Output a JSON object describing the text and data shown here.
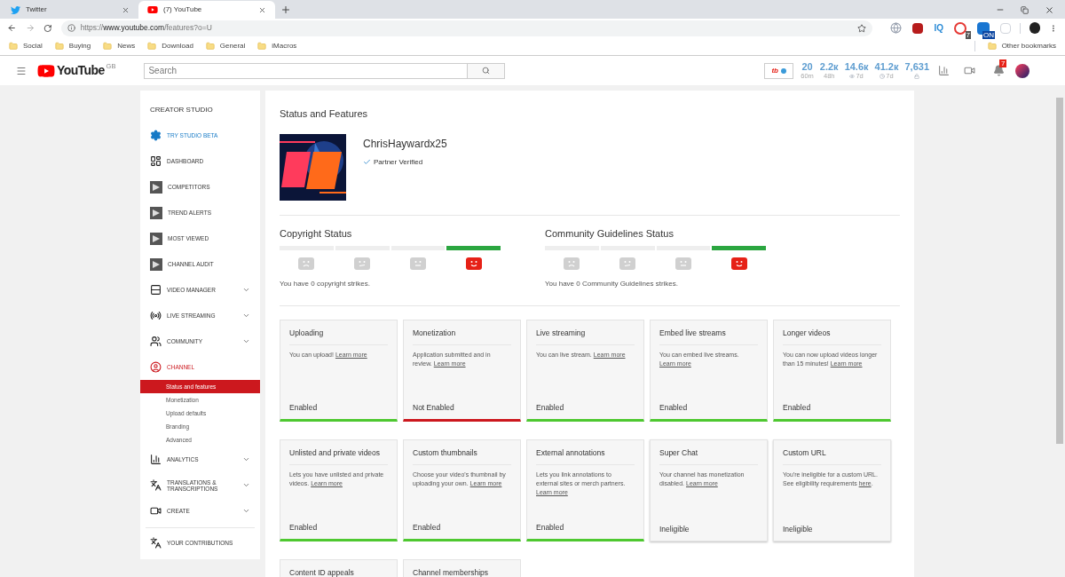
{
  "browser": {
    "tabs": [
      {
        "title": "Twitter",
        "kind": "twitter",
        "selected": false
      },
      {
        "title": "(7) YouTube",
        "kind": "youtube",
        "selected": true
      }
    ],
    "url_scheme": "https://",
    "url_host": "www.youtube.com",
    "url_path": "/features?o=U",
    "extensions": [
      {
        "kind": "globe"
      },
      {
        "kind": "red_square"
      },
      {
        "kind": "text",
        "label": "IQ"
      },
      {
        "kind": "badge_red",
        "badge": "7"
      },
      {
        "kind": "badge_blue",
        "badge": "ON"
      },
      {
        "kind": "blank"
      }
    ],
    "bookmarks": [
      "Social",
      "Buying",
      "News",
      "Download",
      "General",
      "iMacros"
    ],
    "other_bookmarks": "Other bookmarks"
  },
  "header": {
    "logo": "YouTube",
    "region": "GB",
    "search_placeholder": "Search",
    "widget_logo": "tb",
    "notification_count": "7",
    "stats": [
      {
        "value": "20",
        "sub": "60m",
        "kind": "plain"
      },
      {
        "value": "2.2к",
        "sub": "48h",
        "kind": "plain"
      },
      {
        "value": "14.6к",
        "sub": "7d",
        "kind": "views"
      },
      {
        "value": "41.2к",
        "sub": "7d",
        "kind": "time"
      },
      {
        "value": "7,631",
        "kind": "lock"
      }
    ]
  },
  "sidebar": {
    "title": "CREATOR STUDIO",
    "items": [
      {
        "label": "TRY STUDIO BETA",
        "kind": "gear",
        "expandable": false,
        "selected": false
      },
      {
        "label": "DASHBOARD",
        "kind": "dashboard",
        "expandable": false,
        "selected": false
      },
      {
        "label": "COMPETITORS",
        "kind": "plugin",
        "expandable": false,
        "selected": false
      },
      {
        "label": "TREND ALERTS",
        "kind": "plugin",
        "expandable": false,
        "selected": false
      },
      {
        "label": "MOST VIEWED",
        "kind": "plugin",
        "expandable": false,
        "selected": false
      },
      {
        "label": "CHANNEL AUDIT",
        "kind": "plugin",
        "expandable": false,
        "selected": false
      },
      {
        "label": "VIDEO MANAGER",
        "kind": "manager",
        "expandable": true,
        "selected": false
      },
      {
        "label": "LIVE STREAMING",
        "kind": "live",
        "expandable": true,
        "selected": false
      },
      {
        "label": "COMMUNITY",
        "kind": "community",
        "expandable": true,
        "selected": false
      },
      {
        "label": "CHANNEL",
        "kind": "channel",
        "expandable": false,
        "selected": true,
        "children": [
          {
            "label": "Status and features",
            "selected": true
          },
          {
            "label": "Monetization",
            "selected": false
          },
          {
            "label": "Upload defaults",
            "selected": false
          },
          {
            "label": "Branding",
            "selected": false
          },
          {
            "label": "Advanced",
            "selected": false
          }
        ]
      },
      {
        "label": "ANALYTICS",
        "kind": "analytics",
        "expandable": true,
        "selected": false
      },
      {
        "label": "TRANSLATIONS & TRANSCRIPTIONS",
        "kind": "translate",
        "expandable": true,
        "selected": false
      },
      {
        "label": "CREATE",
        "kind": "create",
        "expandable": true,
        "selected": false
      },
      {
        "label": "YOUR CONTRIBUTIONS",
        "kind": "translate",
        "expandable": false,
        "selected": false,
        "separated": true
      }
    ]
  },
  "main": {
    "title": "Status and Features",
    "channel_name": "ChrisHaywardx25",
    "verified_label": "Partner Verified",
    "strike_meters": [
      {
        "title": "Copyright Status",
        "segments": [
          {
            "selected": false
          },
          {
            "selected": false
          },
          {
            "selected": false
          },
          {
            "selected": true
          }
        ],
        "message": "You have 0 copyright strikes."
      },
      {
        "title": "Community Guidelines Status",
        "segments": [
          {
            "selected": false
          },
          {
            "selected": false
          },
          {
            "selected": false
          },
          {
            "selected": true
          }
        ],
        "message": "You have 0 Community Guidelines strikes."
      }
    ],
    "features": [
      {
        "title": "Uploading",
        "description": "You can upload!",
        "link": "Learn more",
        "status": "Enabled",
        "kind": "enabled"
      },
      {
        "title": "Monetization",
        "description": "Application submitted and in review.",
        "link": "Learn more",
        "status": "Not Enabled",
        "kind": "not_enabled"
      },
      {
        "title": "Live streaming",
        "description": "You can live stream.",
        "link": "Learn more",
        "status": "Enabled",
        "kind": "enabled"
      },
      {
        "title": "Embed live streams",
        "description": "You can embed live streams.",
        "link": "Learn more",
        "status": "Enabled",
        "kind": "enabled"
      },
      {
        "title": "Longer videos",
        "description": "You can now upload videos longer than 15 minutes!",
        "link": "Learn more",
        "status": "Enabled",
        "kind": "enabled"
      },
      {
        "title": "Unlisted and private videos",
        "description": "Lets you have unlisted and private videos.",
        "link": "Learn more",
        "status": "Enabled",
        "kind": "enabled"
      },
      {
        "title": "Custom thumbnails",
        "description": "Choose your video's thumbnail by uploading your own.",
        "link": "Learn more",
        "status": "Enabled",
        "kind": "enabled"
      },
      {
        "title": "External annotations",
        "description": "Lets you link annotations to external sites or merch partners.",
        "link": "Learn more",
        "status": "Enabled",
        "kind": "enabled"
      },
      {
        "title": "Super Chat",
        "description": "Your channel has monetization disabled.",
        "link": "Learn more",
        "status": "Ineligible",
        "kind": "ineligible"
      },
      {
        "title": "Custom URL",
        "description": "You're ineligible for a custom URL. See eligibility requirements",
        "link": "here",
        "after": ".",
        "status": "Ineligible",
        "kind": "ineligible"
      },
      {
        "title": "Content ID appeals"
      },
      {
        "title": "Channel memberships"
      }
    ]
  }
}
